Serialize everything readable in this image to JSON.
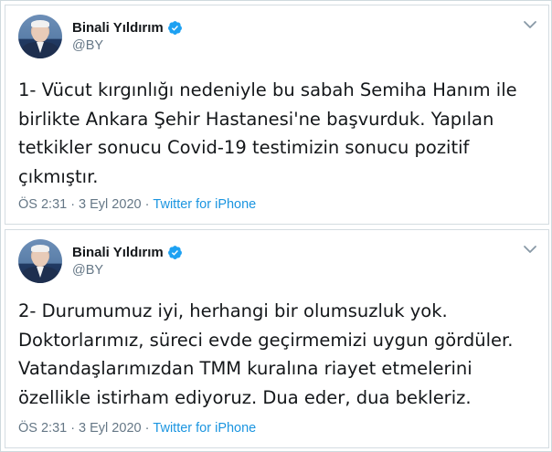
{
  "colors": {
    "verified": "#1da1f2",
    "link": "#1b95e0",
    "secondary_text": "#657786",
    "border": "#d4dce1"
  },
  "tweets": [
    {
      "author": {
        "name": "Binali Yıldırım",
        "handle": "@BY",
        "verified": true,
        "avatar_icon": "profile-photo"
      },
      "text_lines": [
        "1- Vücut kırgınlığı nedeniyle bu sabah Semiha Hanım ile",
        "birlikte Ankara Şehir Hastanesi'ne başvurduk. Yapılan",
        "tetkikler sonucu Covid-19 testimizin sonucu pozitif",
        "çıkmıştır."
      ],
      "time": "ÖS 2:31",
      "separator": "·",
      "date": "3 Eyl 2020",
      "source": "Twitter for iPhone",
      "menu_icon": "chevron-down-icon"
    },
    {
      "author": {
        "name": "Binali Yıldırım",
        "handle": "@BY",
        "verified": true,
        "avatar_icon": "profile-photo"
      },
      "text_lines": [
        "2- Durumumuz iyi, herhangi bir olumsuzluk yok.",
        "Doktorlarımız, süreci evde geçirmemizi uygun gördüler.",
        "Vatandaşlarımızdan TMM kuralına riayet etmelerini",
        "özellikle istirham ediyoruz. Dua eder, dua bekleriz."
      ],
      "time": "ÖS 2:31",
      "separator": "·",
      "date": "3 Eyl 2020",
      "source": "Twitter for iPhone",
      "menu_icon": "chevron-down-icon"
    }
  ]
}
